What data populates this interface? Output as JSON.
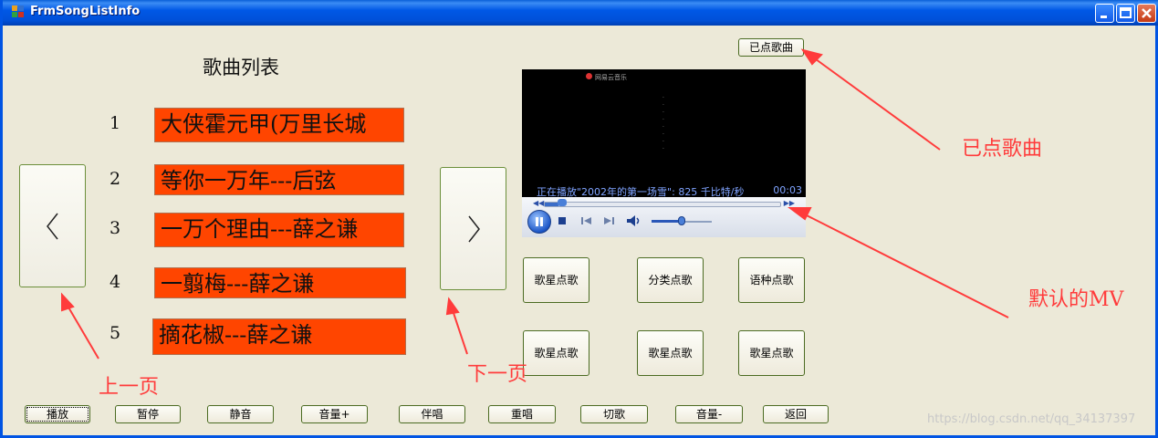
{
  "window": {
    "title": "FrmSongListInfo"
  },
  "heading": "歌曲列表",
  "songs": [
    {
      "num": "1",
      "title": "大侠霍元甲(万里长城"
    },
    {
      "num": "2",
      "title": "等你一万年---后弦"
    },
    {
      "num": "3",
      "title": "一万个理由---薛之谦"
    },
    {
      "num": "4",
      "title": "一翦梅---薛之谦"
    },
    {
      "num": "5",
      "title": "摘花椒---薛之谦"
    }
  ],
  "nav": {
    "prev_icon": "chevron-left-icon",
    "next_icon": "chevron-right-icon"
  },
  "top_button": "已点歌曲",
  "player": {
    "logo": "网易云音乐",
    "status": "正在播放\"2002年的第一场雪\": 825 千比特/秒",
    "time": "00:03",
    "progress": 0.06,
    "volume": 0.5
  },
  "grid_buttons": [
    [
      "歌星点歌",
      "分类点歌",
      "语种点歌"
    ],
    [
      "歌星点歌",
      "歌星点歌",
      "歌星点歌"
    ]
  ],
  "bottom_buttons": [
    "播放",
    "暂停",
    "静音",
    "音量+",
    "伴唱",
    "重唱",
    "切歌",
    "音量-",
    "返回"
  ],
  "annotations": {
    "selected": "已点歌曲",
    "default_mv": "默认的MV",
    "prev_page": "上一页",
    "next_page": "下一页"
  },
  "watermark": "https://blog.csdn.net/qq_34137397",
  "colors": {
    "song_bg": "#ff4500",
    "annotation": "#ff3b3b",
    "titlebar": "#0054e3"
  }
}
